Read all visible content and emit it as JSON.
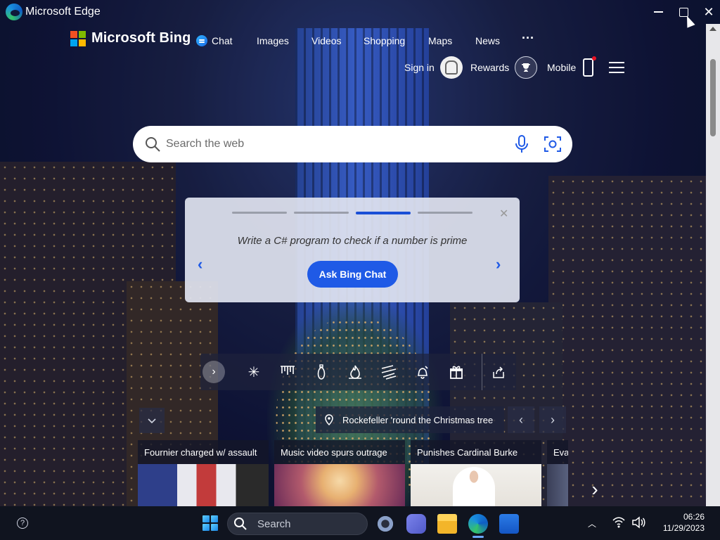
{
  "window": {
    "title": "Microsoft Edge",
    "controls": {
      "minimize": "minimize",
      "maximize": "maximize",
      "close": "✕"
    }
  },
  "header": {
    "logo_text": "Microsoft Bing",
    "nav": [
      {
        "label": "Chat",
        "icon": "chat-bubble-icon"
      },
      {
        "label": "Images"
      },
      {
        "label": "Videos"
      },
      {
        "label": "Shopping"
      },
      {
        "label": "Maps"
      },
      {
        "label": "News"
      },
      {
        "label": "···"
      }
    ],
    "sign_in": "Sign in",
    "rewards": "Rewards",
    "mobile": "Mobile"
  },
  "search": {
    "placeholder": "Search the web",
    "value": ""
  },
  "chat_card": {
    "prompt": "Write a C# program to check if a number is prime",
    "button": "Ask Bing Chat",
    "progress_total": 4,
    "progress_active": 3
  },
  "toolbar": {
    "icons": [
      "snowflake-icon",
      "icicles-icon",
      "ornament-icon",
      "fire-icon",
      "snow-wind-icon",
      "bell-icon",
      "gift-icon"
    ],
    "share_icon": "share-icon"
  },
  "image_caption": {
    "text": "Rockefeller 'round the Christmas tree"
  },
  "news": [
    {
      "headline": "Fournier charged w/ assault"
    },
    {
      "headline": "Music video spurs outrage"
    },
    {
      "headline": "Punishes Cardinal Burke"
    },
    {
      "headline": "Eva"
    }
  ],
  "taskbar": {
    "search_label": "Search",
    "time": "06:26",
    "date": "11/29/2023"
  },
  "colors": {
    "bing_blue": "#1f5ae6",
    "taskbar": "#10141f",
    "card_bg": "#e1e4f0"
  }
}
